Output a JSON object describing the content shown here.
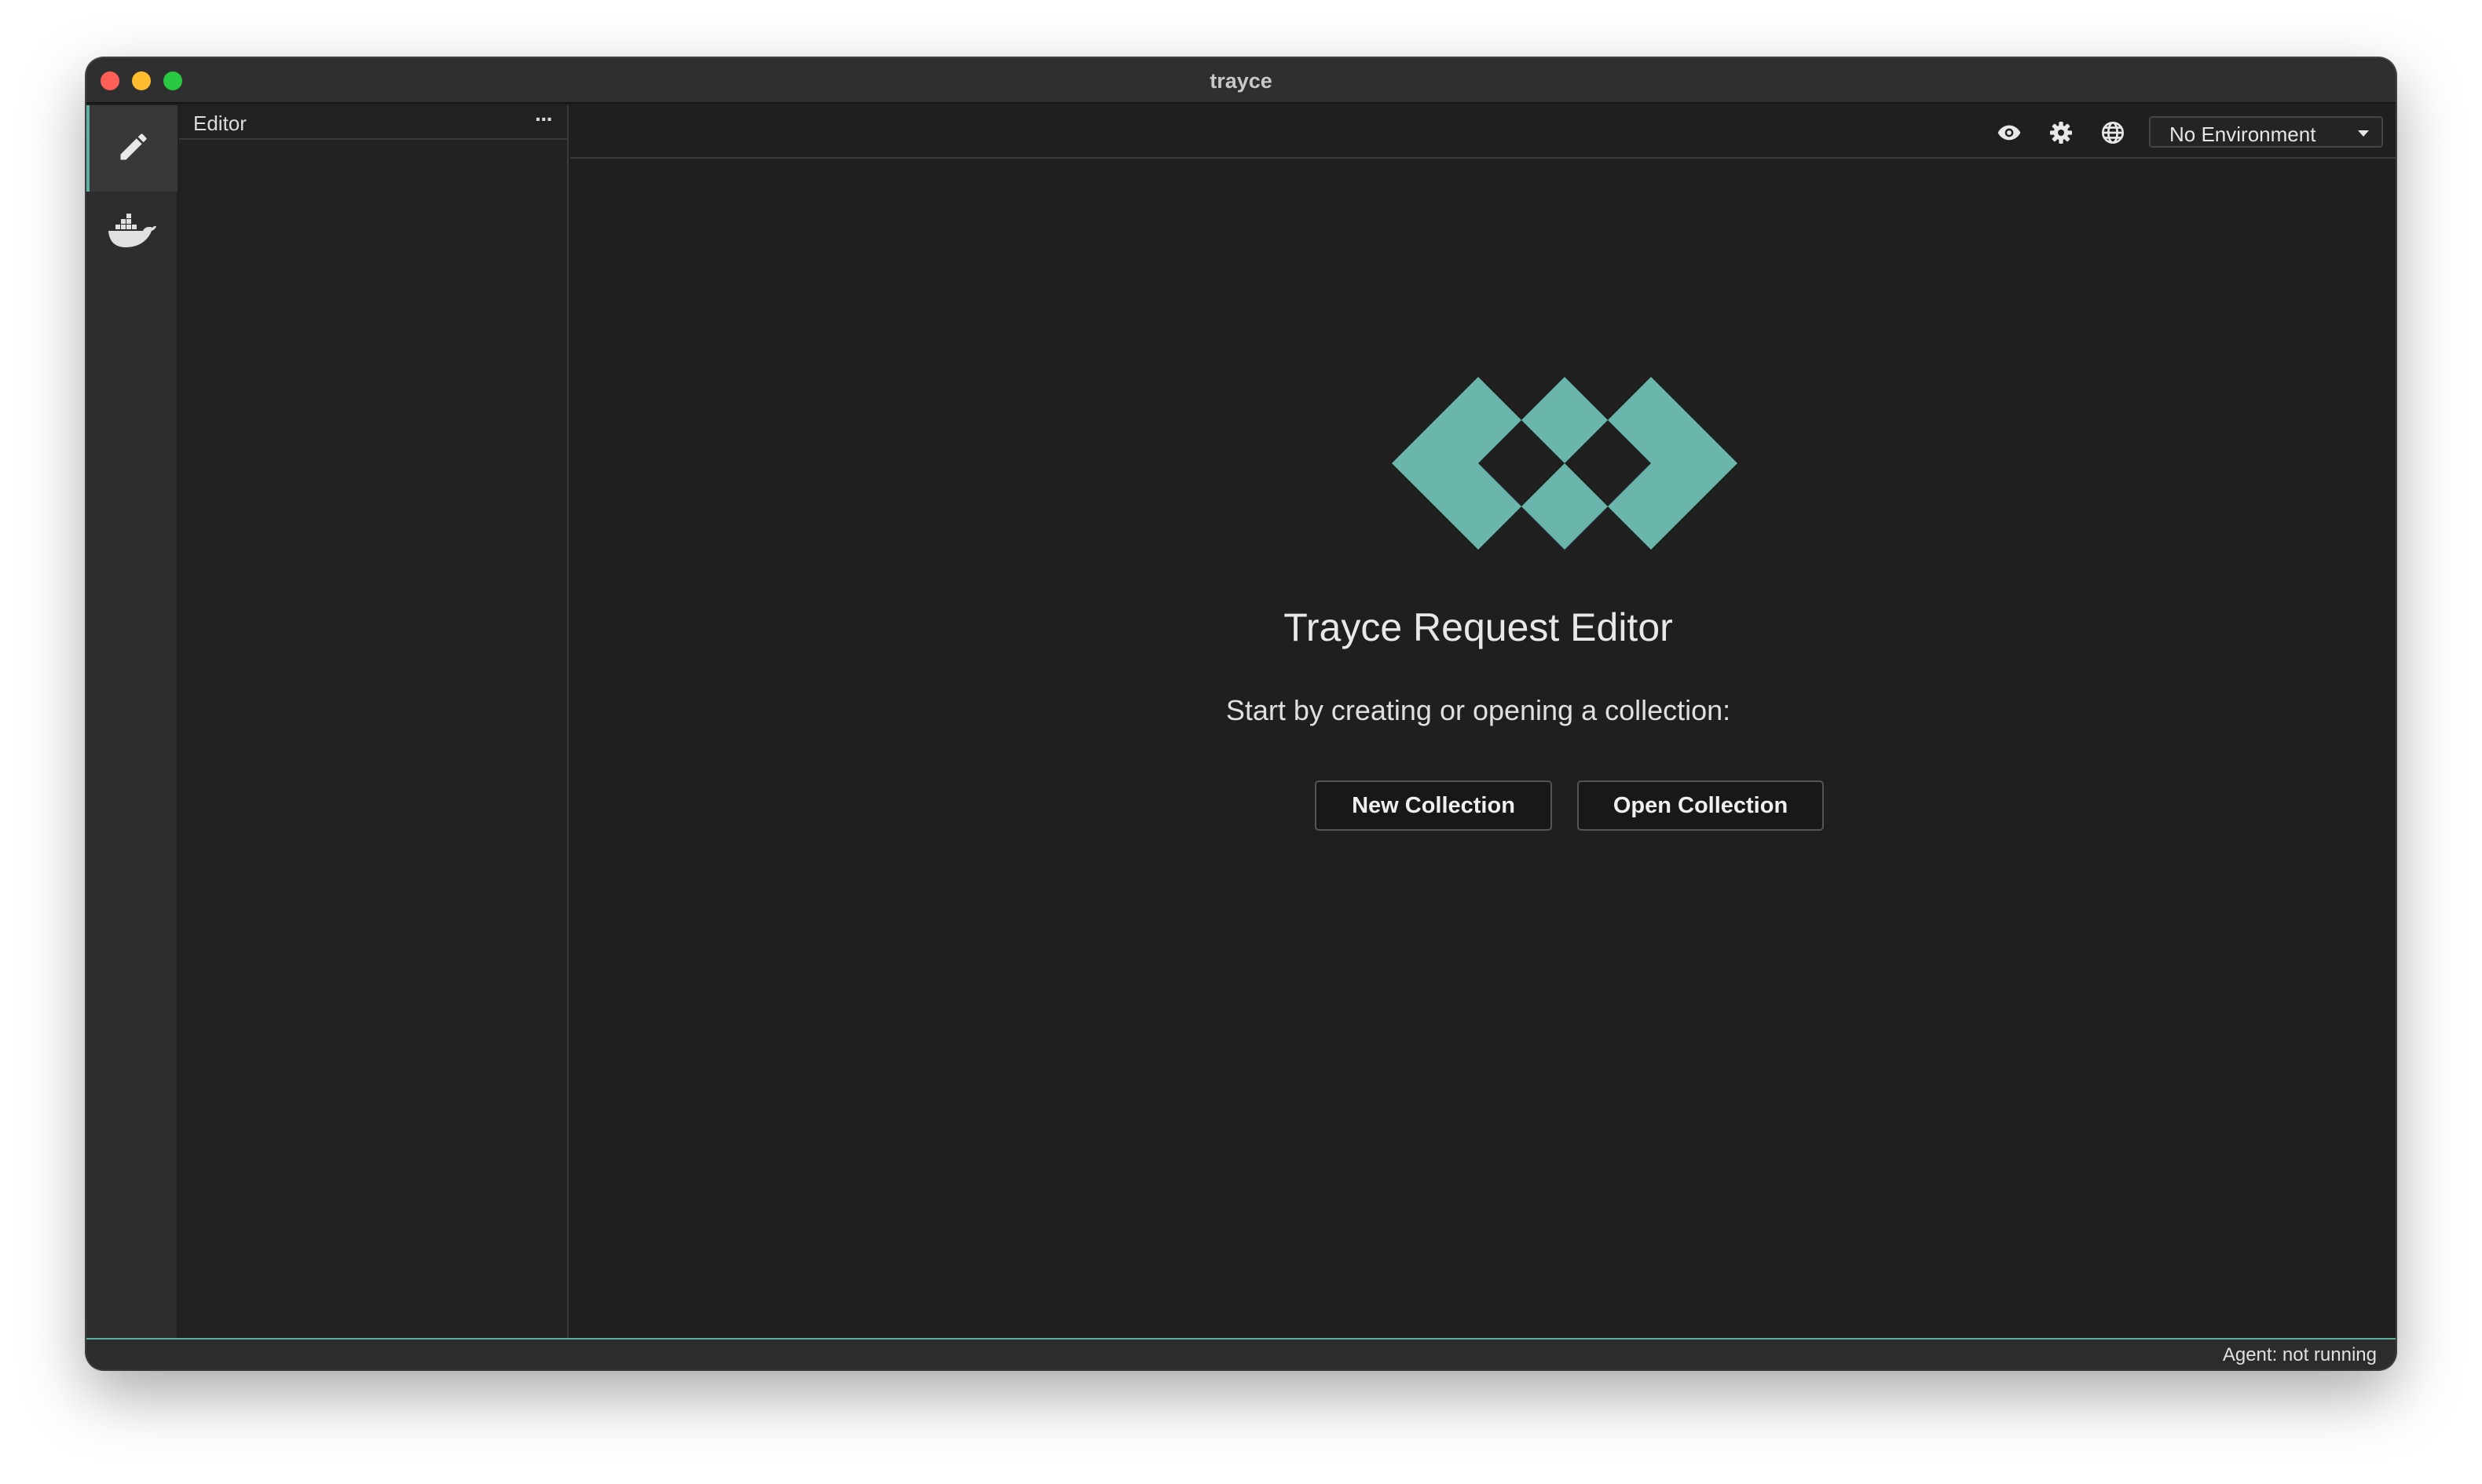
{
  "window": {
    "title": "trayce"
  },
  "colors": {
    "accent": "#5eaea2",
    "background": "#1f1f1f"
  },
  "activity_bar": {
    "items": [
      {
        "icon": "pencil-icon",
        "active": true
      },
      {
        "icon": "docker-icon",
        "active": false
      }
    ]
  },
  "sidebar": {
    "title": "Editor",
    "more_label": "···"
  },
  "toolbar": {
    "icons": [
      "eye-icon",
      "gear-icon",
      "globe-icon"
    ],
    "environment": {
      "selected": "No Environment"
    }
  },
  "main": {
    "logo": "trayce-logo",
    "heading": "Trayce Request Editor",
    "subtitle": "Start by creating or opening a collection:",
    "new_collection_label": "New Collection",
    "open_collection_label": "Open Collection"
  },
  "statusbar": {
    "agent_status": "Agent: not running"
  }
}
